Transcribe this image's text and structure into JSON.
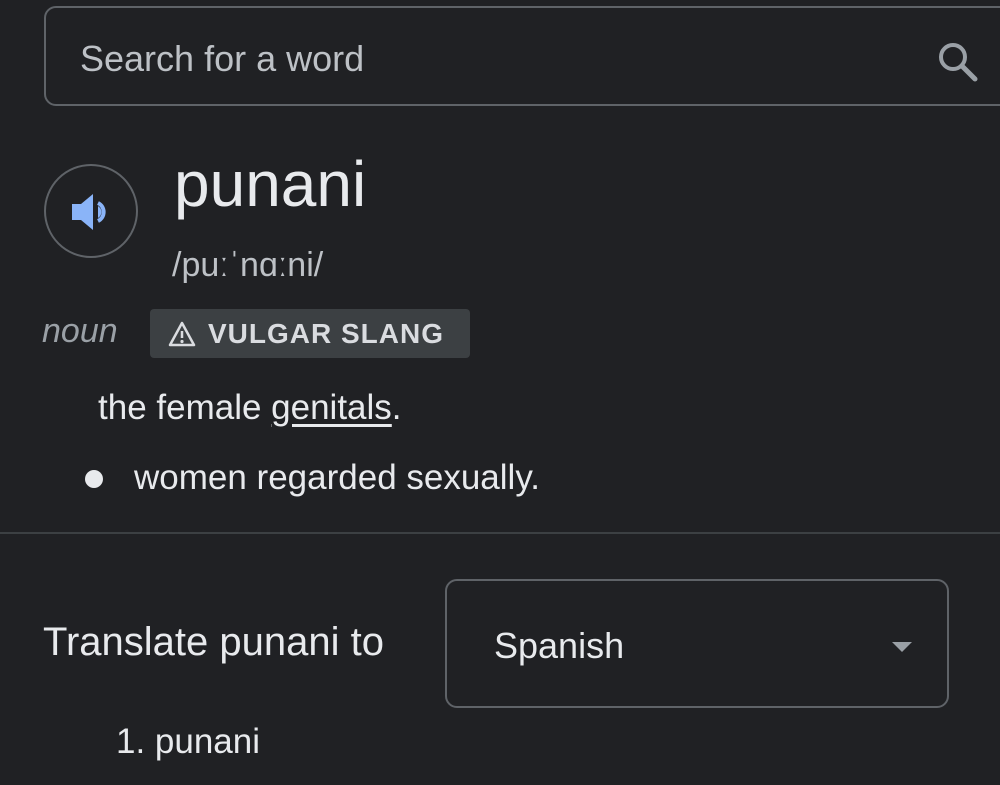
{
  "search": {
    "placeholder": "Search for a word",
    "icon": "search-icon"
  },
  "entry": {
    "word": "punani",
    "phonetic": "/puːˈnɑːni/",
    "part_of_speech": "noun",
    "label": "VULGAR SLANG",
    "label_icon": "warning-icon",
    "definition": {
      "prefix": "the female ",
      "link": "genitals",
      "suffix": "."
    },
    "subsense": "women regarded sexually."
  },
  "translate": {
    "label": "Translate punani to",
    "selected_language": "Spanish",
    "results": [
      "1. punani"
    ]
  },
  "colors": {
    "background": "#202124",
    "text": "#e8eaed",
    "secondary_text": "#bdc1c6",
    "border": "#5f6368",
    "badge_bg": "#3c4043",
    "accent_blue": "#8ab4f8"
  }
}
